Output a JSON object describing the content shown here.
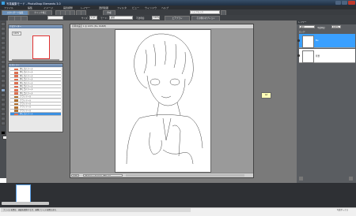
{
  "window": {
    "title": "写真編集モード - PhotoShop Elements 3.0"
  },
  "menu": [
    "ファイル",
    "編集",
    "イメージ",
    "画質調整",
    "レイヤー",
    "選択範囲",
    "フィルタ",
    "ビュー",
    "ウィンドウ",
    "ヘルプ"
  ],
  "toolbar1": {
    "items": [
      "スタンダード編集",
      "クイック修正"
    ],
    "search_placeholder": "ヘルプを入力",
    "create_label": "作成"
  },
  "toolbar2": {
    "size_label": "サイズ:",
    "size_value": "1 px",
    "mode_label": "モード:",
    "mode_value": "通常",
    "opacity_label": "不透明度:",
    "opacity_value": "100%",
    "airbrush_label": "エアブラシ",
    "more_options_label": "その他のオプション"
  },
  "navigator": {
    "title": "ナビゲーター",
    "zoom": "100%"
  },
  "history": {
    "title": "ヒストリー",
    "items": [
      {
        "label": "消しゴムツール",
        "selected": false
      },
      {
        "label": "消しゴムツール",
        "selected": false
      },
      {
        "label": "消しゴムツール",
        "selected": false
      },
      {
        "label": "消しゴムツール",
        "selected": false
      },
      {
        "label": "消しゴムツール",
        "selected": false
      },
      {
        "label": "消しゴムツール",
        "selected": false
      },
      {
        "label": "消しゴムツール",
        "selected": false
      },
      {
        "label": "消しゴムツール",
        "selected": false
      },
      {
        "label": "ブラシツール",
        "selected": false
      },
      {
        "label": "ブラシツール",
        "selected": false
      },
      {
        "label": "ブラシツール",
        "selected": false
      },
      {
        "label": "ブラシツール",
        "selected": false
      },
      {
        "label": "ブラシツール",
        "selected": false
      },
      {
        "label": "消しゴムツール",
        "selected": true
      }
    ]
  },
  "document": {
    "title": "名称未設定 1 @ 100% (Bu, RGB/8)",
    "zoom": "100%",
    "dimensions": "28.9mm x 42.4mm (350 ppi)"
  },
  "tooltip": "A4",
  "layers_panel": {
    "title": "レイヤー",
    "blend_mode": "通常",
    "opacity_label": "不透明度:",
    "opacity_value": "100%",
    "lock_label": "ロック:",
    "layers": [
      {
        "name": "Bu",
        "selected": true
      },
      {
        "name": "背景",
        "selected": false
      }
    ]
  },
  "statusbar": {
    "text": "ファイルを開き、画面を選択するか、画像ファイルを開きます。",
    "right": "写真ボックス"
  },
  "colors": {
    "accent": "#3b8fe0",
    "titlebar": "#2b3f56",
    "workspace": "#7a7a7a"
  }
}
